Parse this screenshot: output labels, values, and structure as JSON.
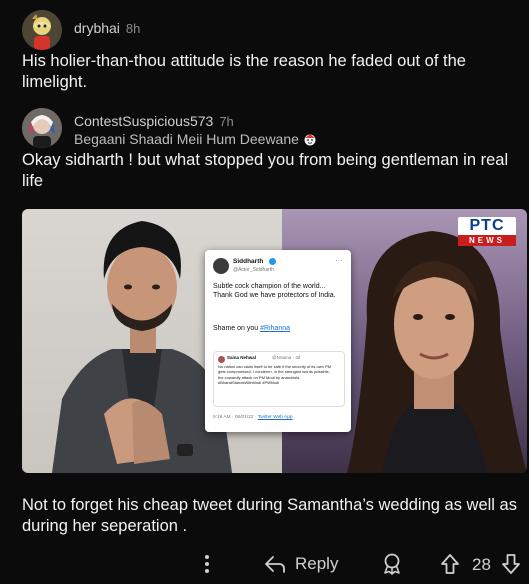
{
  "comment1": {
    "username": "drybhai",
    "time": "8h",
    "text": "His holier-than-thou attitude is the reason he faded out of the limelight."
  },
  "comment2": {
    "username": "ContestSuspicious573",
    "time": "7h",
    "flair": "Begaani Shaadi Meii Hum Deewane",
    "text": "Okay sidharth ! but what stopped you from being gentleman in real life",
    "image": {
      "logo_top": "PTC",
      "logo_bottom": "NEWS",
      "tweet": {
        "name": "Siddharth",
        "handle": "@Actor_Siddharth",
        "text": "Subtle cock champion of the world... Thank God we have protectors of India.",
        "shame": "Shame on you",
        "hashtag": "#Rihanna",
        "quote": {
          "name": "Saina Nehwal",
          "handle": "@NSaina · 3d",
          "text": "No nation can claim itself to be safe if the security of its own PM gets compromised. I condemn, in the strongest words possible, the cowardly attack on PM Modi by anarchists. #BharatStandsWithModi #PMModi"
        },
        "footer": "9:19 AM · 06/01/22 ·",
        "footer_link": "Twitter Web App"
      }
    },
    "text2": "Not to forget his cheap tweet during Samantha’s wedding as well as during her seperation ."
  },
  "actions": {
    "reply_label": "Reply",
    "vote_count": "28"
  }
}
